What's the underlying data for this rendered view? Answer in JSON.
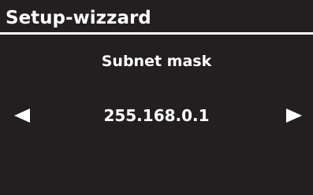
{
  "header": {
    "title": "Setup-wizzard"
  },
  "main": {
    "label": "Subnet mask",
    "value": "255.168.0.1"
  },
  "controls": {
    "prev_icon": "triangle-left-icon",
    "next_icon": "triangle-right-icon"
  },
  "colors": {
    "background": "#231f20",
    "foreground": "#ffffff"
  }
}
